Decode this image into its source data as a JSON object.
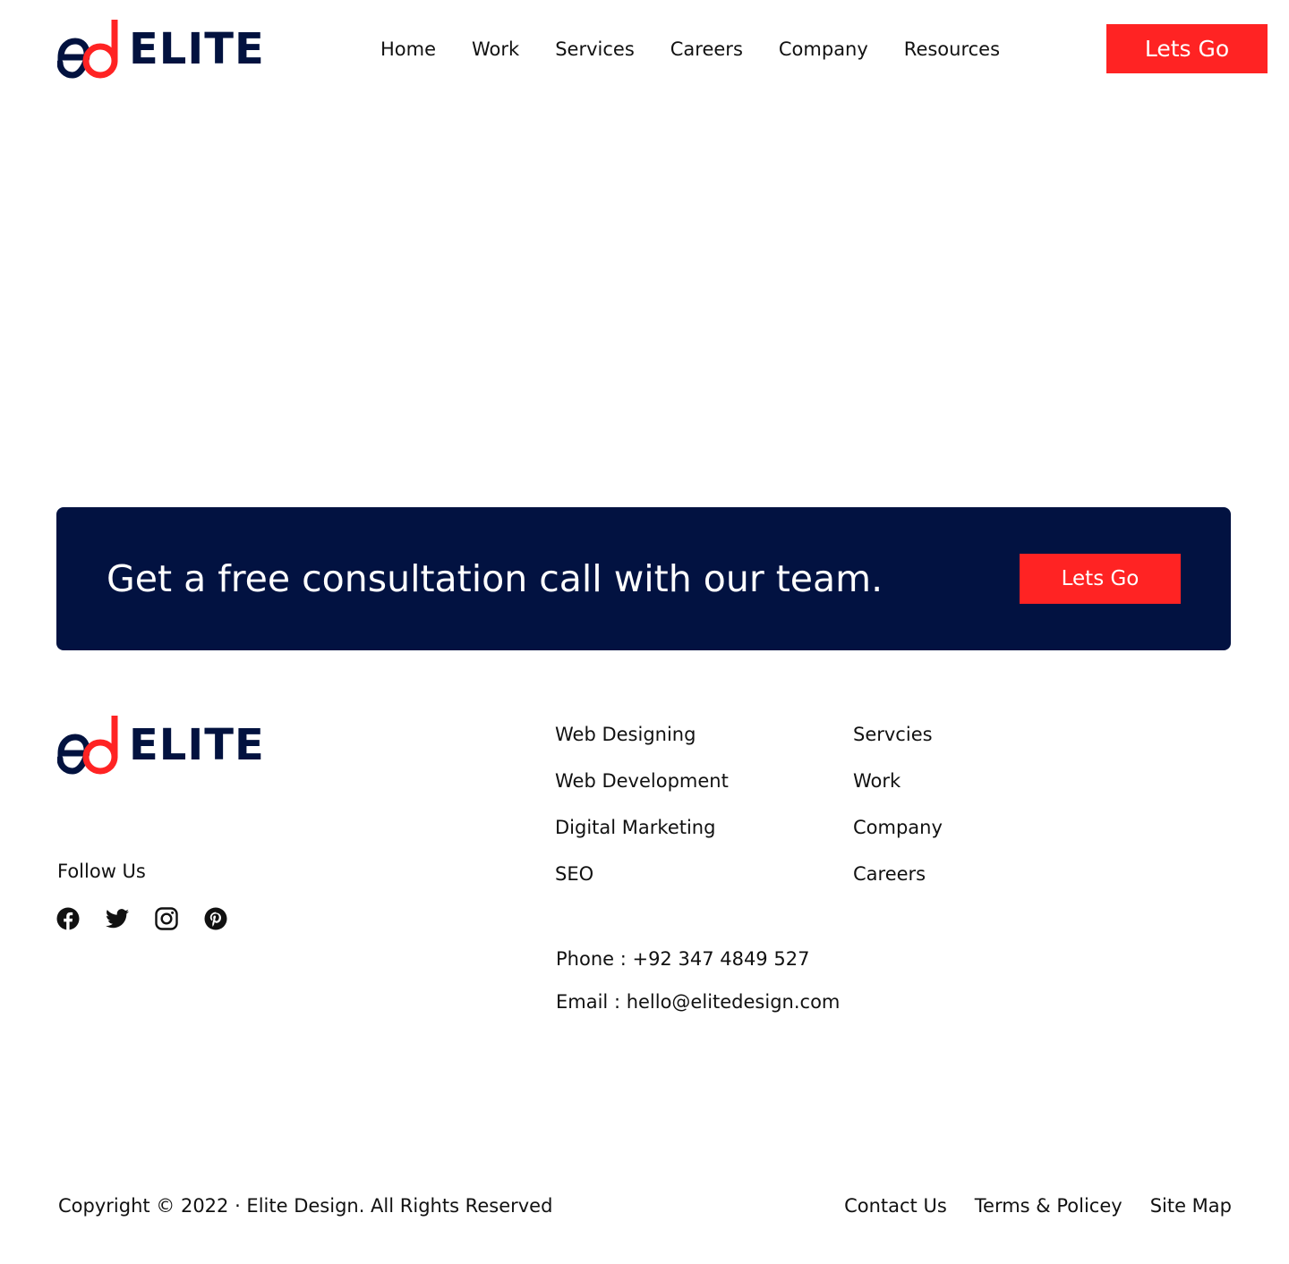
{
  "brand": {
    "wordmark": "ELITE",
    "colors": {
      "navy": "#02123f",
      "red": "#ff2323",
      "banner": "#021241"
    }
  },
  "header": {
    "nav": [
      "Home",
      "Work",
      "Services",
      "Careers",
      "Company",
      "Resources"
    ],
    "cta_label": "Lets Go"
  },
  "cta_banner": {
    "text": "Get a free consultation call with our team.",
    "button_label": "Lets Go"
  },
  "footer": {
    "follow_label": "Follow Us",
    "socials": [
      "facebook-icon",
      "twitter-icon",
      "instagram-icon",
      "pinterest-icon"
    ],
    "services": [
      "Web Designing",
      "Web Development",
      "Digital Marketing",
      "SEO"
    ],
    "links": [
      "Servcies",
      "Work",
      "Company",
      "Careers"
    ],
    "phone": "Phone : +92 347 4849 527",
    "email": "Email : hello@elitedesign.com",
    "copyright": "Copyright © 2022 · Elite Design. All Rights Reserved",
    "legal": [
      "Contact Us",
      "Terms & Policey",
      "Site Map"
    ]
  }
}
